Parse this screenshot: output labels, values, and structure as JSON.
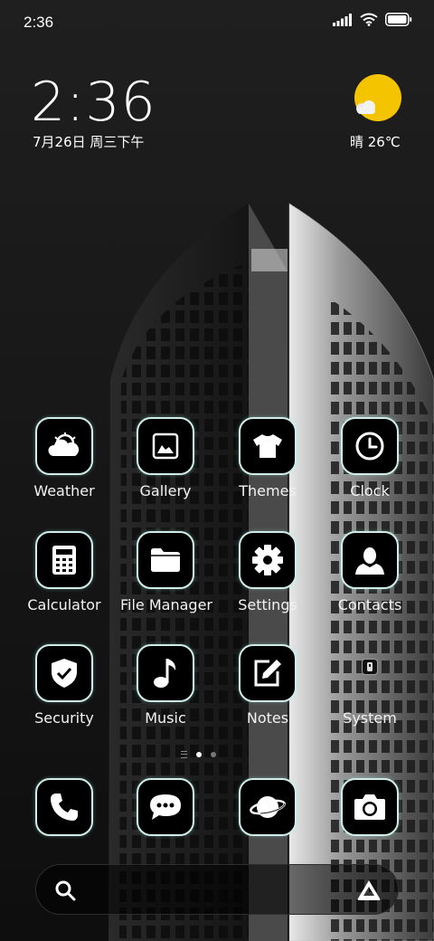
{
  "status_bar": {
    "time": "2:36",
    "icons": [
      "signal-icon",
      "wifi-icon",
      "battery-icon"
    ]
  },
  "clock_widget": {
    "time": "2:36",
    "date": "7月26日 周三下午"
  },
  "weather_widget": {
    "text": "晴 26℃",
    "icon": "sunny-cloud-icon",
    "sun_color": "#f5c400"
  },
  "apps": [
    {
      "label": "Weather",
      "icon": "weather-icon"
    },
    {
      "label": "Gallery",
      "icon": "gallery-icon"
    },
    {
      "label": "Themes",
      "icon": "themes-icon"
    },
    {
      "label": "Clock",
      "icon": "clock-icon"
    },
    {
      "label": "Calculator",
      "icon": "calculator-icon"
    },
    {
      "label": "File Manager",
      "icon": "folder-icon"
    },
    {
      "label": "Settings",
      "icon": "gear-icon"
    },
    {
      "label": "Contacts",
      "icon": "contacts-icon"
    },
    {
      "label": "Security",
      "icon": "shield-icon"
    },
    {
      "label": "Music",
      "icon": "music-note-icon"
    },
    {
      "label": "Notes",
      "icon": "notes-icon"
    },
    {
      "label": "System",
      "icon": "system-folder-icon"
    }
  ],
  "pager": {
    "pages": 2,
    "active": 1
  },
  "dock": [
    {
      "icon": "phone-icon"
    },
    {
      "icon": "messages-icon"
    },
    {
      "icon": "browser-icon"
    },
    {
      "icon": "camera-icon"
    }
  ],
  "search_bar": {
    "left_icon": "search-icon",
    "right_icon": "assistant-icon"
  },
  "colors": {
    "icon_border": "#cfeeea",
    "background": "#141414",
    "accent_sun": "#f5c400"
  }
}
